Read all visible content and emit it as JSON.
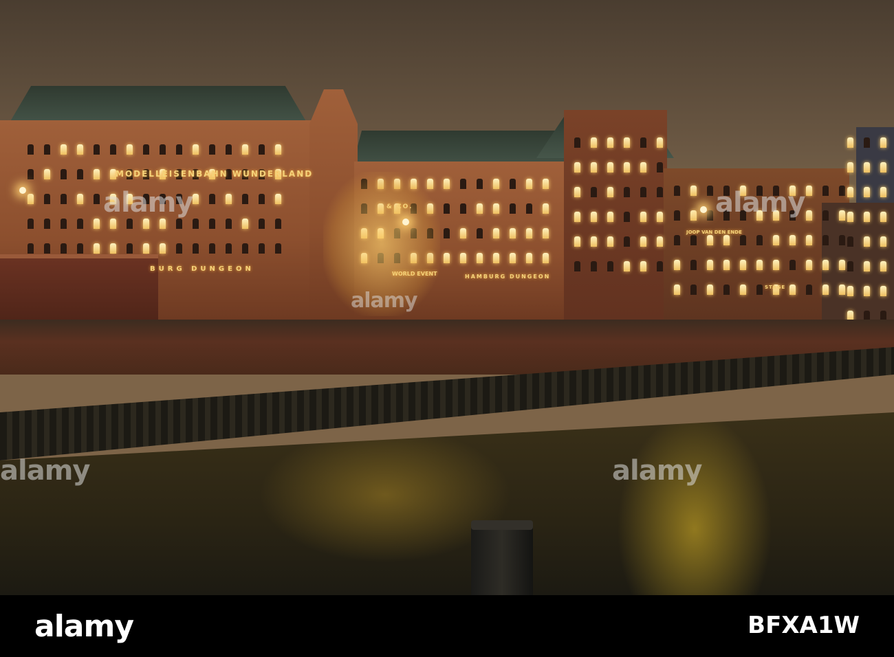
{
  "signs": {
    "wunderland": "MODELLEISENBAHN WUNDERLAND",
    "dungeon_left": "BURG DUNGEON",
    "dungeon_right": "HAMBURG DUNGEON",
    "world_event": "WORLD EVENT",
    "and_co": "& CO.",
    "joop": "JOOP VAN DEN ENDE",
    "stage": "STAGE"
  },
  "watermark": {
    "text": "alamy"
  },
  "footer": {
    "logo": "alamy",
    "image_id": "BFXA1W"
  },
  "colors": {
    "sky": "#86704f",
    "brick": "#8c4f2e",
    "water": "#2a2414",
    "light": "#f4d27a"
  }
}
